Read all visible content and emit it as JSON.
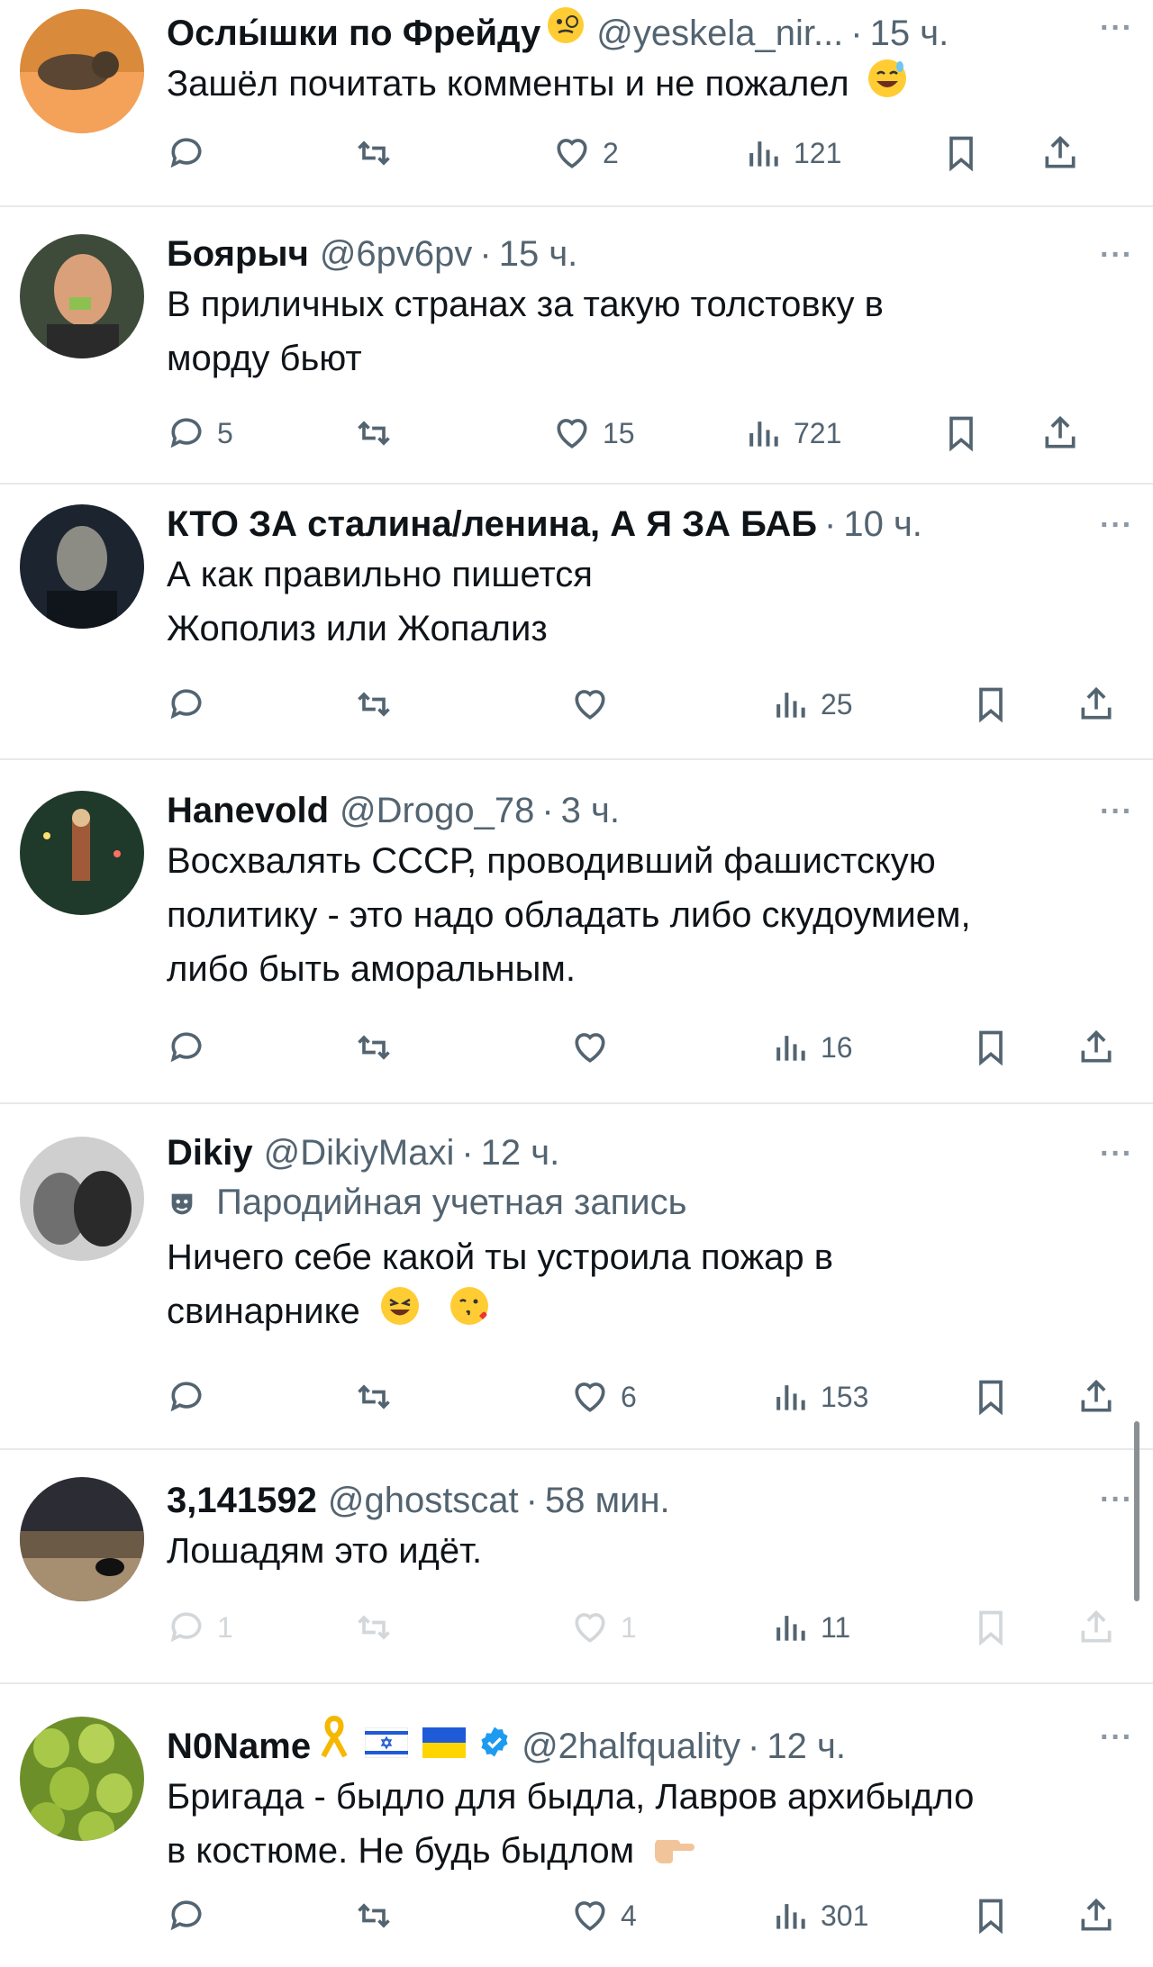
{
  "tweets": [
    {
      "name": "Ослы́шки по Фрейду",
      "handle": "@yeskela_nir...",
      "time": "15 ч.",
      "lines": [
        "Зашёл почитать комменты и не пожалел"
      ],
      "replies": "",
      "reposts": "",
      "likes": "2",
      "views": "121"
    },
    {
      "name": "Боярыч",
      "handle": "@6pv6pv",
      "time": "15 ч.",
      "lines": [
        "В приличных странах за такую толстовку в",
        "морду бьют"
      ],
      "replies": "5",
      "reposts": "",
      "likes": "15",
      "views": "721"
    },
    {
      "name": "КТО ЗА сталина/ленина, А Я ЗА БАБ",
      "handle": "",
      "time": "10 ч.",
      "lines": [
        "А как правильно пишется",
        "Жополиз или Жопализ"
      ],
      "replies": "",
      "reposts": "",
      "likes": "",
      "views": "25"
    },
    {
      "name": "Hanevold",
      "handle": "@Drogo_78",
      "time": "3 ч.",
      "lines": [
        "Восхвалять СССР, проводивший фашистскую",
        "политику - это надо обладать либо скудоумием,",
        "либо быть аморальным."
      ],
      "replies": "",
      "reposts": "",
      "likes": "",
      "views": "16"
    },
    {
      "name": "Dikiy",
      "handle": "@DikiyMaxi",
      "time": "12 ч.",
      "badge": "Пародийная учетная запись",
      "lines": [
        "Ничего себе какой ты устроила пожар в",
        "свинарнике"
      ],
      "replies": "",
      "reposts": "",
      "likes": "6",
      "views": "153"
    },
    {
      "name": "3,141592",
      "handle": "@ghostscat",
      "time": "58 мин.",
      "lines": [
        "Лошадям это идёт."
      ],
      "replies": "1",
      "reposts": "",
      "likes": "1",
      "views": "11"
    },
    {
      "name": "N0Name",
      "handle": "@2halfquality",
      "time": "12 ч.",
      "lines": [
        "Бригада - быдло для быдла, Лавров архибыдло",
        "в костюме. Не будь быдлом"
      ],
      "replies": "",
      "reposts": "",
      "likes": "4",
      "views": "301"
    }
  ],
  "icons": {
    "reply": "reply-icon",
    "repost": "repost-icon",
    "like": "like-icon",
    "views": "views-icon",
    "bookmark": "bookmark-icon",
    "share": "share-icon",
    "more": "more-icon",
    "parody": "parody-mask-icon",
    "verified": "verified-badge-icon"
  },
  "colors": {
    "text": "#0f1419",
    "secondary": "#536471",
    "divider": "#e7e9ea",
    "verified": "#1d9bf0"
  }
}
